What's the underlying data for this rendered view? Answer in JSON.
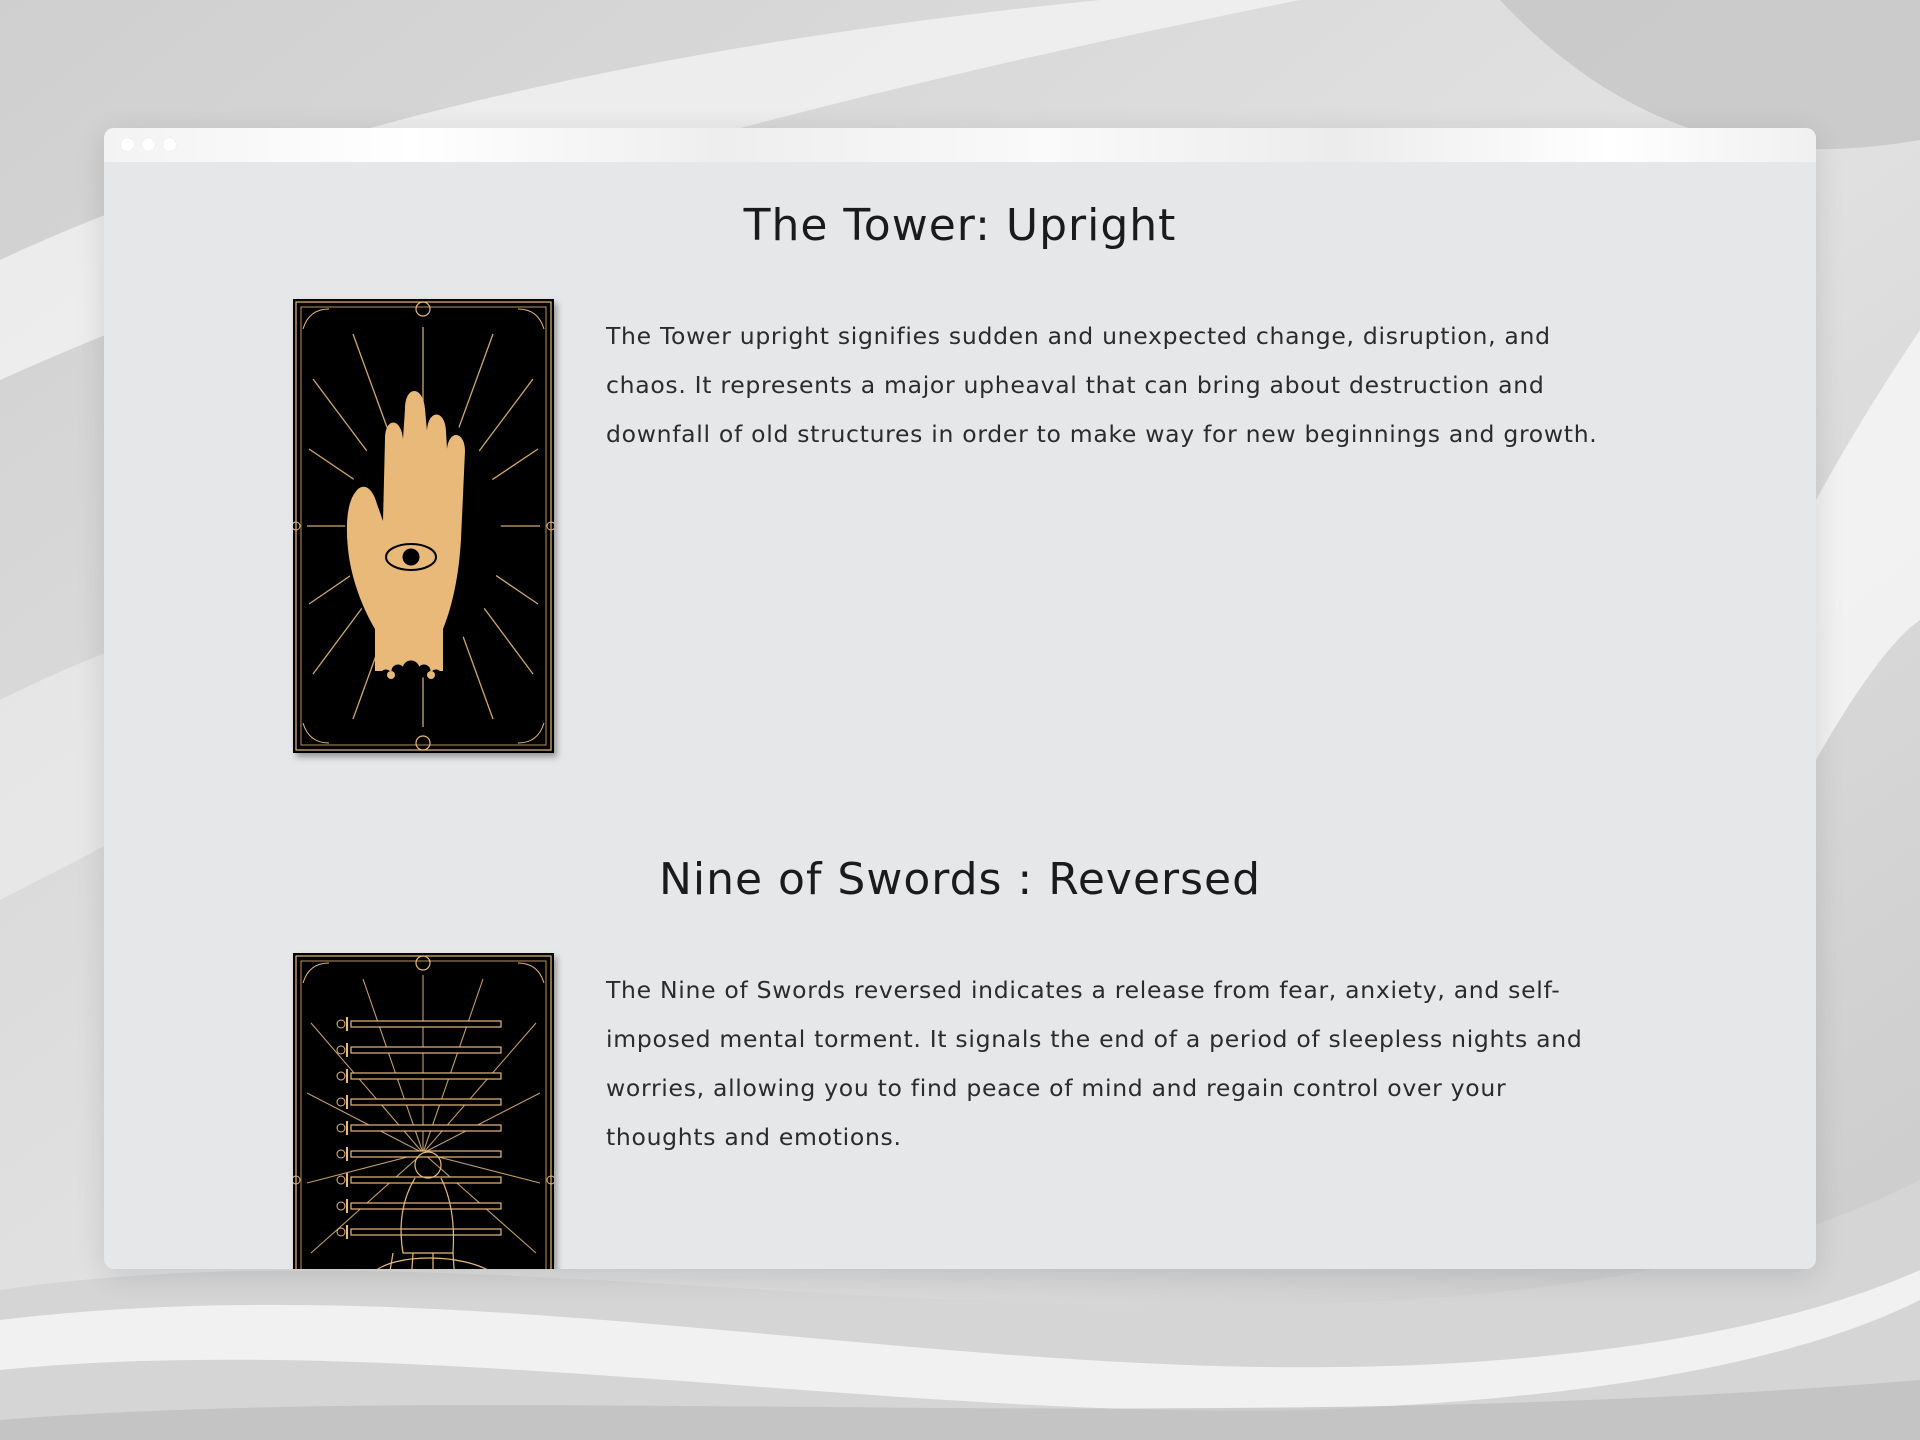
{
  "sections": [
    {
      "title": "The Tower: Upright",
      "card_icon": "palm-eye-icon",
      "description": "The Tower upright signifies sudden and unexpected change, disruption, and chaos. It represents a major upheaval that can bring about destruction and downfall of old structures in order to make way for new beginnings and growth."
    },
    {
      "title": "Nine of Swords : Reversed",
      "card_icon": "nine-swords-icon",
      "description": "The Nine of Swords reversed indicates a release from fear, anxiety, and self-imposed mental torment. It signals the end of a period of sleepless nights and worries, allowing you to find peace of mind and regain control over your thoughts and emotions."
    }
  ],
  "colors": {
    "card_background": "#000000",
    "card_gold": "#e8b978",
    "page_background": "#e6e7e9",
    "heading_text": "#1b1b1b",
    "body_text": "#2b2b2b"
  }
}
